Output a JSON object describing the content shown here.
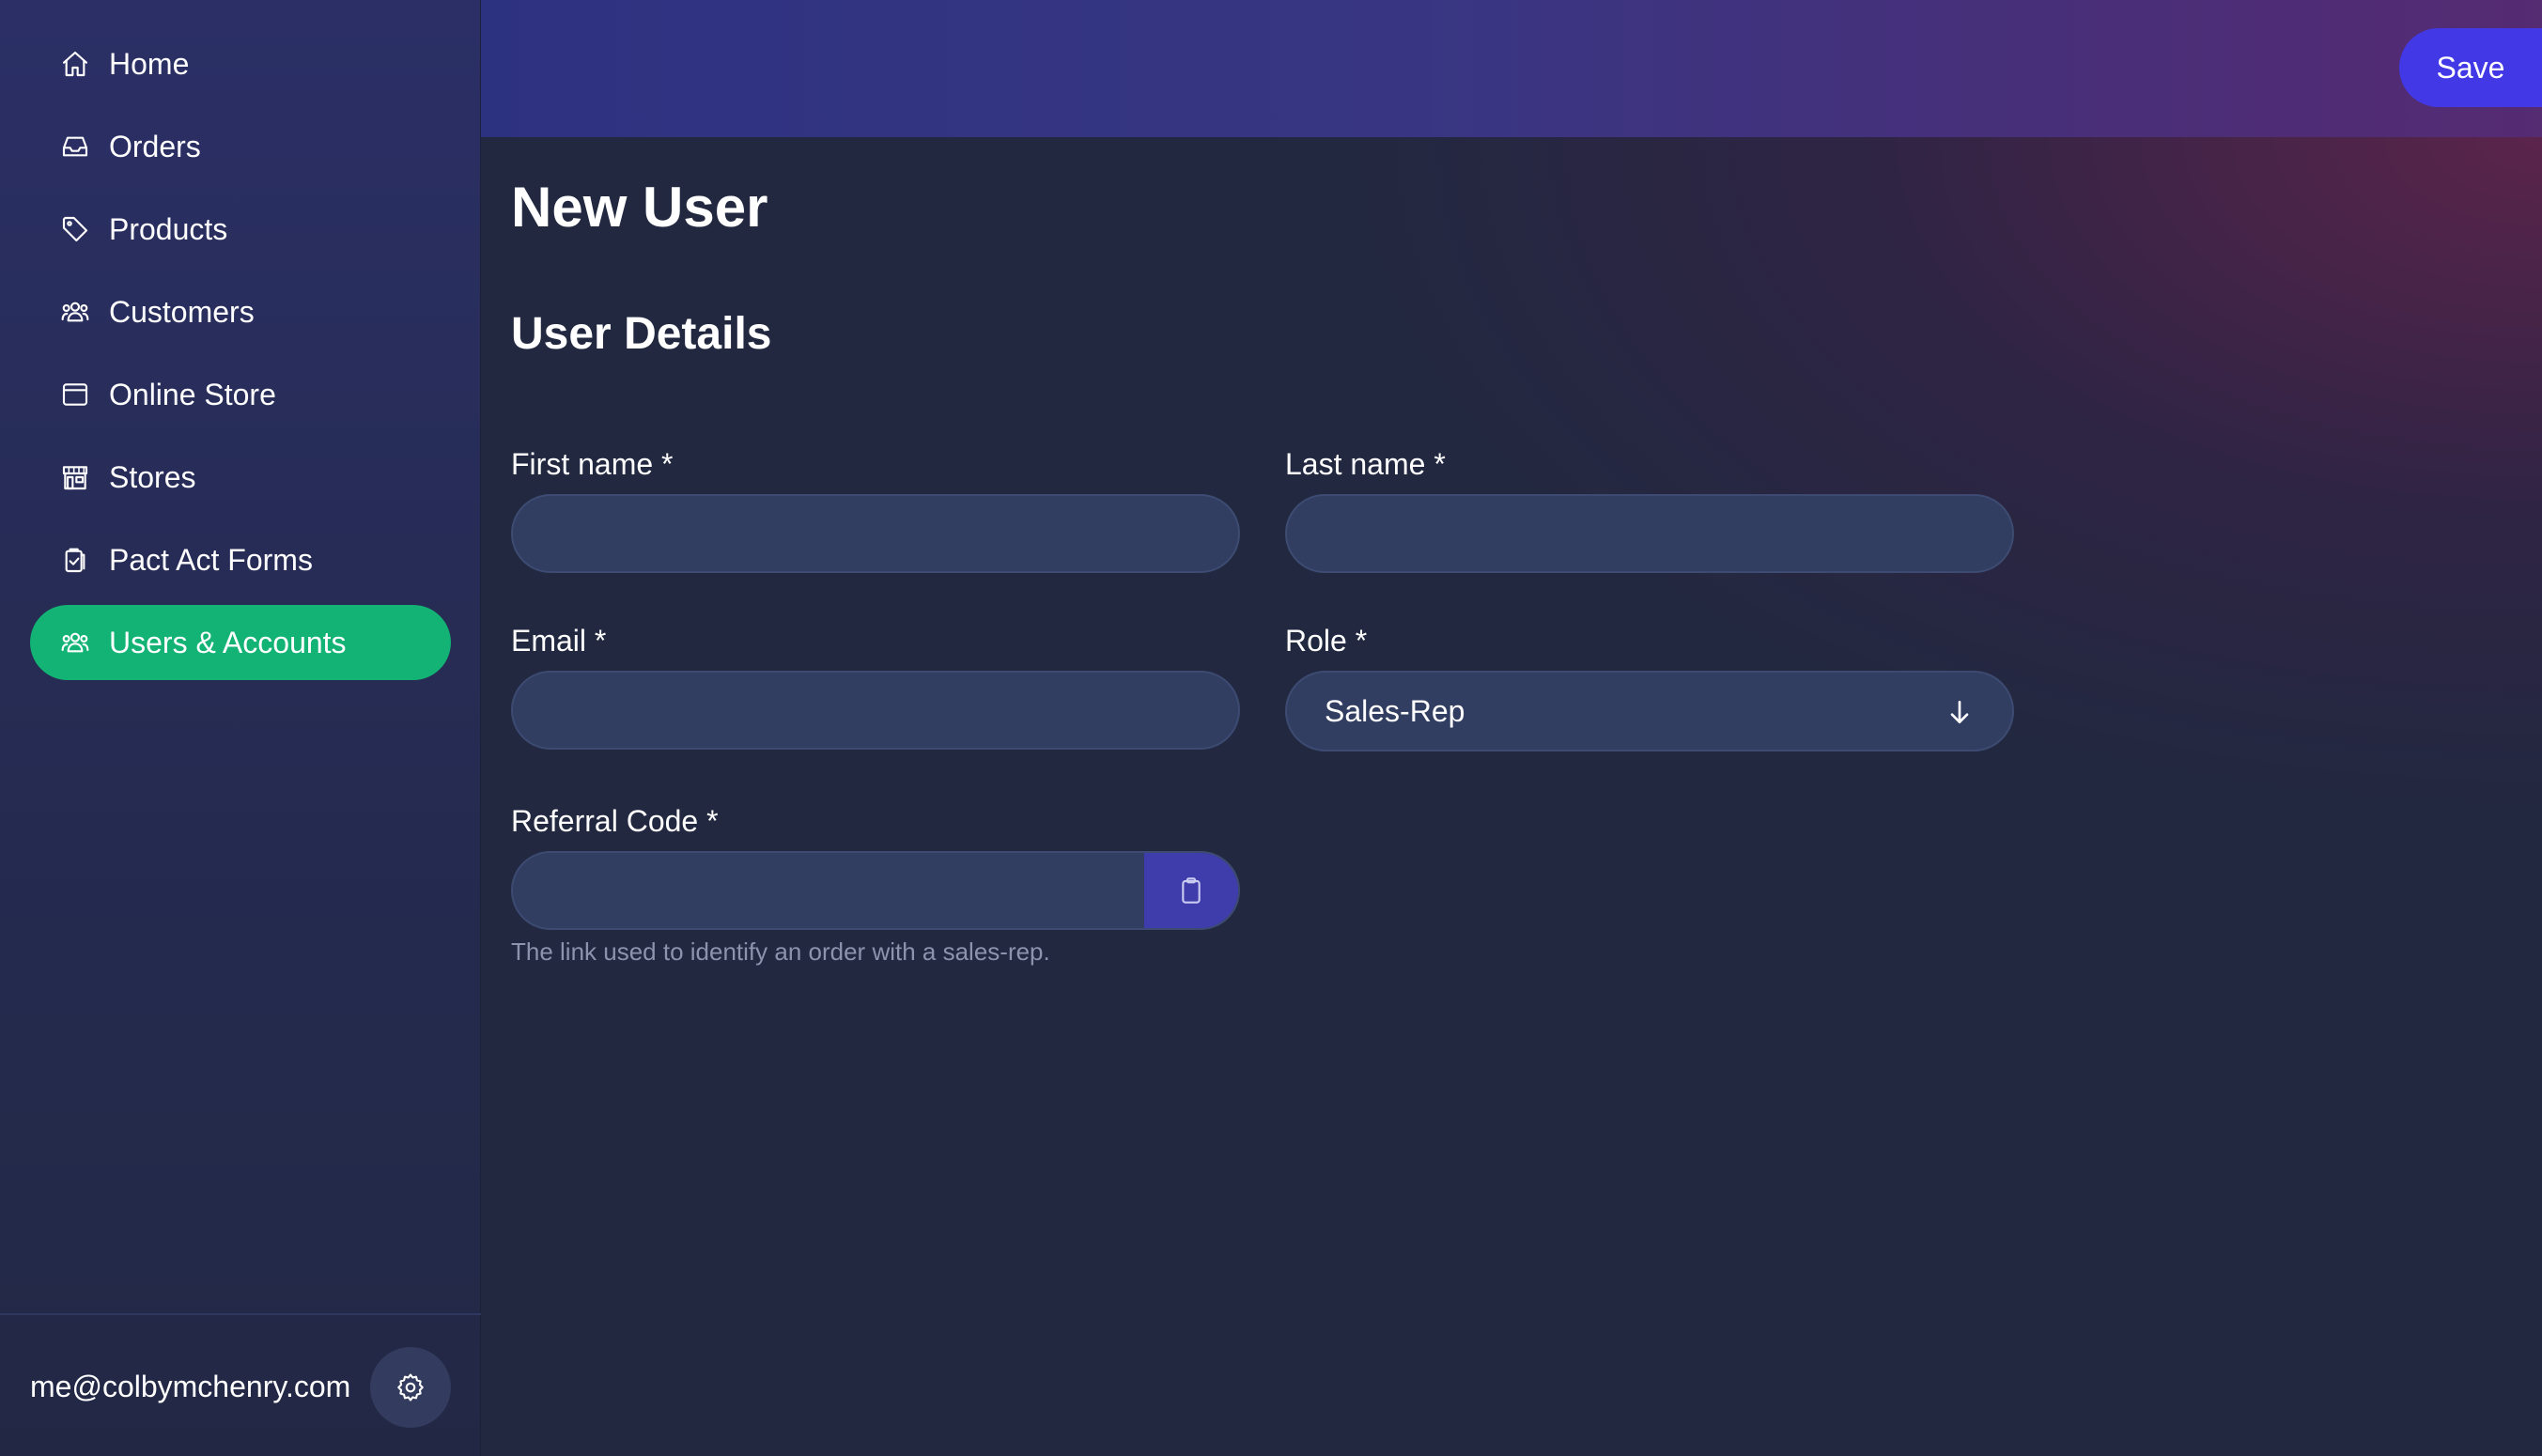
{
  "sidebar": {
    "items": [
      {
        "label": "Home",
        "icon": "home-icon",
        "active": false
      },
      {
        "label": "Orders",
        "icon": "inbox-icon",
        "active": false
      },
      {
        "label": "Products",
        "icon": "tag-icon",
        "active": false
      },
      {
        "label": "Customers",
        "icon": "users-icon",
        "active": false
      },
      {
        "label": "Online Store",
        "icon": "browser-window-icon",
        "active": false
      },
      {
        "label": "Stores",
        "icon": "storefront-icon",
        "active": false
      },
      {
        "label": "Pact Act Forms",
        "icon": "clipboard-check-icon",
        "active": false
      },
      {
        "label": "Users & Accounts",
        "icon": "users-icon",
        "active": true
      }
    ],
    "user_email": "me@colbymchenry.com",
    "settings_icon": "gear-icon"
  },
  "topbar": {
    "save_label": "Save"
  },
  "main": {
    "page_title": "New User",
    "section_title": "User Details",
    "fields": {
      "first_name": {
        "label": "First name *",
        "value": ""
      },
      "last_name": {
        "label": "Last name *",
        "value": ""
      },
      "email": {
        "label": "Email *",
        "value": ""
      },
      "role": {
        "label": "Role *",
        "value": "Sales-Rep",
        "icon": "arrow-down-icon"
      },
      "referral_code": {
        "label": "Referral Code *",
        "value": "",
        "help": "The link used to identify an order with a sales-rep.",
        "button_icon": "clipboard-icon"
      }
    }
  },
  "colors": {
    "active_nav": "#12b374",
    "save_button": "#4338e6",
    "input_bg": "#313e62",
    "copy_button": "#3f3cab"
  }
}
